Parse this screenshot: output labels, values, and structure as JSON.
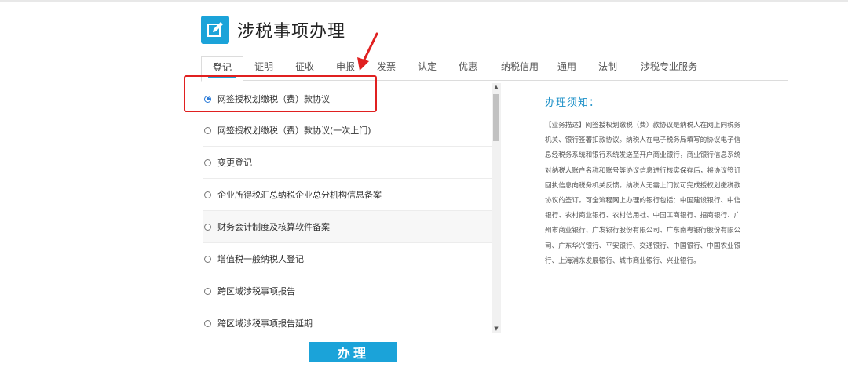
{
  "header": {
    "title": "涉税事项办理",
    "logo_icon": "edit-icon",
    "accent_color": "#1ba3d9"
  },
  "tabs": [
    {
      "label": "登记",
      "active": true
    },
    {
      "label": "证明"
    },
    {
      "label": "征收"
    },
    {
      "label": "申报"
    },
    {
      "label": "发票"
    },
    {
      "label": "认定"
    },
    {
      "label": "优惠"
    },
    {
      "label": "纳税信用"
    },
    {
      "label": "通用"
    },
    {
      "label": "法制"
    },
    {
      "label": "涉税专业服务"
    }
  ],
  "items": [
    {
      "label": "网签授权划缴税（费）款协议",
      "selected": true
    },
    {
      "label": "网签授权划缴税（费）款协议(一次上门)"
    },
    {
      "label": "变更登记"
    },
    {
      "label": "企业所得税汇总纳税企业总分机构信息备案"
    },
    {
      "label": "财务会计制度及核算软件备案"
    },
    {
      "label": "增值税一般纳税人登记"
    },
    {
      "label": "跨区域涉税事项报告"
    },
    {
      "label": "跨区域涉税事项报告延期"
    }
  ],
  "notice": {
    "title": "办理须知：",
    "lines": [
      "【业务描述】网签授权划缴税（费）款协议是纳税人在网上同税务",
      "机关、银行签署扣款协议。纳税人在电子税务局填写的协议电子信",
      "息经税务系统和银行系统发送至开户商业银行，商业银行信息系统",
      "对纳税人账户名称和账号等协议信息进行核实保存后，将协议签订",
      "回执信息向税务机关反馈。纳税人无需上门就可完成授权划缴税款",
      "协议的签订。可全流程网上办理的银行包括：中国建设银行、中信",
      "银行、农村商业银行、农村信用社、中国工商银行、招商银行、广",
      "州市商业银行、广发银行股份有限公司、广东南粤银行股份有限公",
      "司、广东华兴银行、平安银行、交通银行、中国银行、中国农业银",
      "行、上海浦东发展银行、城市商业银行、兴业银行。"
    ]
  },
  "action": {
    "label": "办理"
  },
  "annotation": {
    "color": "#e02020"
  }
}
